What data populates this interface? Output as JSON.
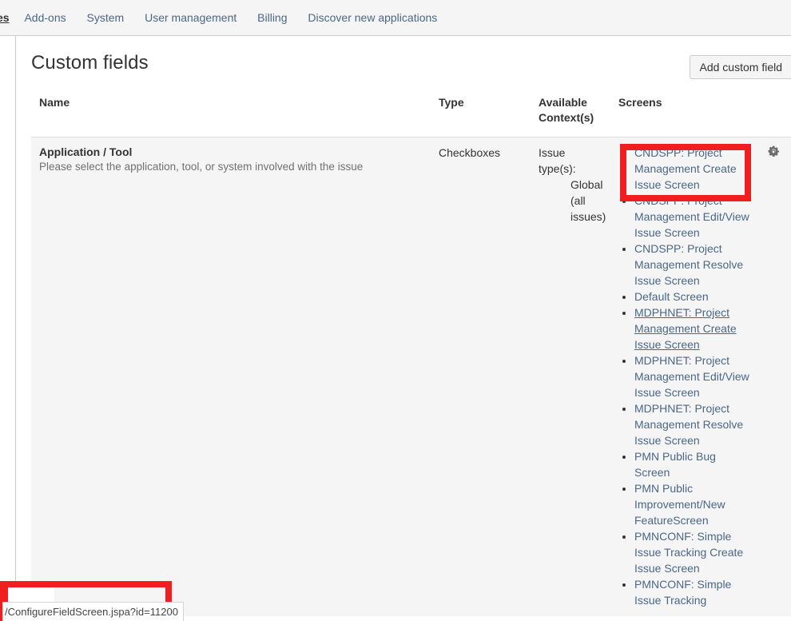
{
  "nav": {
    "items": [
      {
        "label": "es",
        "clipped": true
      },
      {
        "label": "Add-ons",
        "clipped": false
      },
      {
        "label": "System",
        "clipped": false
      },
      {
        "label": "User management",
        "clipped": false
      },
      {
        "label": "Billing",
        "clipped": false
      },
      {
        "label": "Discover new applications",
        "clipped": false
      }
    ]
  },
  "page": {
    "title": "Custom fields",
    "add_button_label": "Add custom field"
  },
  "table": {
    "headers": {
      "name": "Name",
      "type": "Type",
      "context": "Available Context(s)",
      "screens": "Screens"
    },
    "row": {
      "field_name": "Application / Tool",
      "field_description": "Please select the application, tool, or system involved with the issue",
      "type": "Checkboxes",
      "context_label": "Issue type(s):",
      "context_value": "Global (all issues)",
      "cog_icon": "gear-icon",
      "screens": [
        {
          "label": "CNDSPP: Project Management Create Issue Screen",
          "highlighted": true,
          "hovered": false
        },
        {
          "label": "CNDSPP: Project Management Edit/View Issue Screen",
          "highlighted": false,
          "hovered": false
        },
        {
          "label": "CNDSPP: Project Management Resolve Issue Screen",
          "highlighted": false,
          "hovered": false
        },
        {
          "label": "Default Screen",
          "highlighted": false,
          "hovered": false
        },
        {
          "label": "MDPHNET: Project Management Create Issue Screen",
          "highlighted": false,
          "hovered": true
        },
        {
          "label": "MDPHNET: Project Management Edit/View Issue Screen",
          "highlighted": false,
          "hovered": false
        },
        {
          "label": "MDPHNET: Project Management Resolve Issue Screen",
          "highlighted": false,
          "hovered": false
        },
        {
          "label": "PMN Public Bug Screen",
          "highlighted": false,
          "hovered": false
        },
        {
          "label": "PMN Public Improvement/New FeatureScreen",
          "highlighted": false,
          "hovered": false
        },
        {
          "label": "PMNCONF: Simple Issue Tracking Create Issue Screen",
          "highlighted": false,
          "hovered": false
        },
        {
          "label": "PMNCONF: Simple Issue Tracking",
          "highlighted": false,
          "hovered": false
        }
      ]
    }
  },
  "status_bar": {
    "url": "/ConfigureFieldScreen.jspa?id=11200"
  },
  "colors": {
    "link": "#4a6785",
    "annotation": "#f01e1e",
    "row_background": "#f5f5f5",
    "nav_background": "#f5f5f5"
  }
}
